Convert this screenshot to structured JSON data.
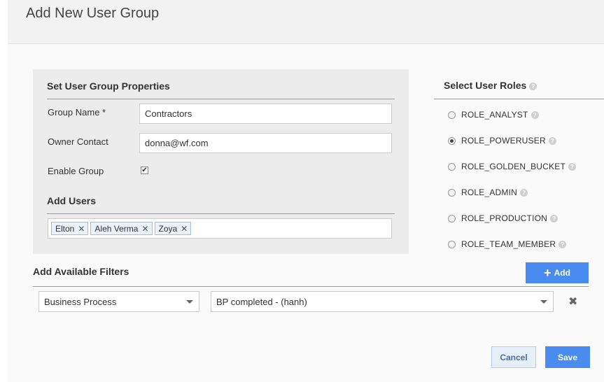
{
  "dialog": {
    "title": "Add New User Group"
  },
  "properties": {
    "section_title": "Set User Group Properties",
    "group_name_label": "Group Name *",
    "group_name_value": "Contractors",
    "owner_contact_label": "Owner Contact",
    "owner_contact_value": "donna@wf.com",
    "enable_group_label": "Enable Group",
    "enable_group_checked": true
  },
  "add_users": {
    "section_title": "Add Users",
    "tags": [
      "Elton",
      "Aleh Verma",
      "Zoya"
    ],
    "remove_glyph": "✕"
  },
  "roles": {
    "section_title": "Select User Roles",
    "help_glyph": "?",
    "items": [
      {
        "label": "ROLE_ANALYST",
        "selected": false
      },
      {
        "label": "ROLE_POWERUSER",
        "selected": true
      },
      {
        "label": "ROLE_GOLDEN_BUCKET",
        "selected": false
      },
      {
        "label": "ROLE_ADMIN",
        "selected": false
      },
      {
        "label": "ROLE_PRODUCTION",
        "selected": false
      },
      {
        "label": "ROLE_TEAM_MEMBER",
        "selected": false
      }
    ]
  },
  "filters": {
    "section_title": "Add Available Filters",
    "add_label": "Add",
    "add_glyph": "+",
    "filter_type_value": "Business Process",
    "filter_value": "BP completed - (hanh)",
    "remove_glyph": "✖"
  },
  "actions": {
    "cancel_label": "Cancel",
    "save_label": "Save"
  },
  "colors": {
    "primary": "#4a8bf0",
    "panel": "#ececec",
    "header": "#f2f2f2"
  }
}
